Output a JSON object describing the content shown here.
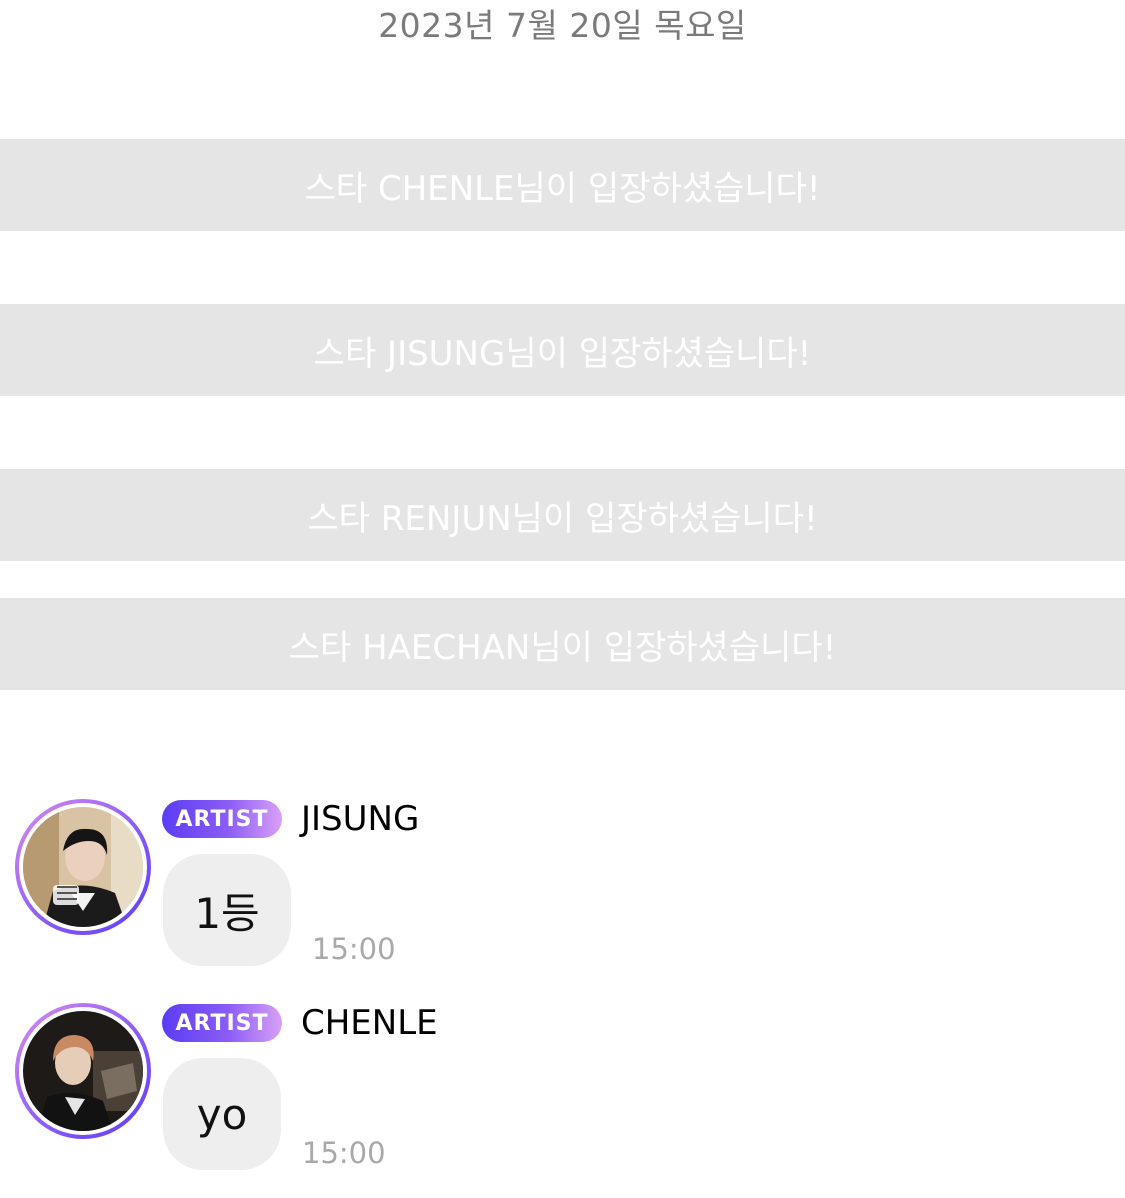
{
  "date_header": "2023년 7월 20일 목요일",
  "notices": [
    "스타 CHENLE님이 입장하셨습니다!",
    "스타 JISUNG님이 입장하셨습니다!",
    "스타 RENJUN님이 입장하셨습니다!",
    "스타 HAECHAN님이 입장하셨습니다!"
  ],
  "messages": [
    {
      "badge": "ARTIST",
      "sender": "JISUNG",
      "text": "1등",
      "time": "15:00"
    },
    {
      "badge": "ARTIST",
      "sender": "CHENLE",
      "text": "yo",
      "time": "15:00"
    }
  ],
  "colors": {
    "notice_bg": "#e5e5e5",
    "bubble_bg": "#eeeeee",
    "badge_gradient_start": "#5b3df5",
    "badge_gradient_end": "#d9a0f5",
    "date_text": "#7a7a7a",
    "time_text": "#a9a9a9"
  }
}
